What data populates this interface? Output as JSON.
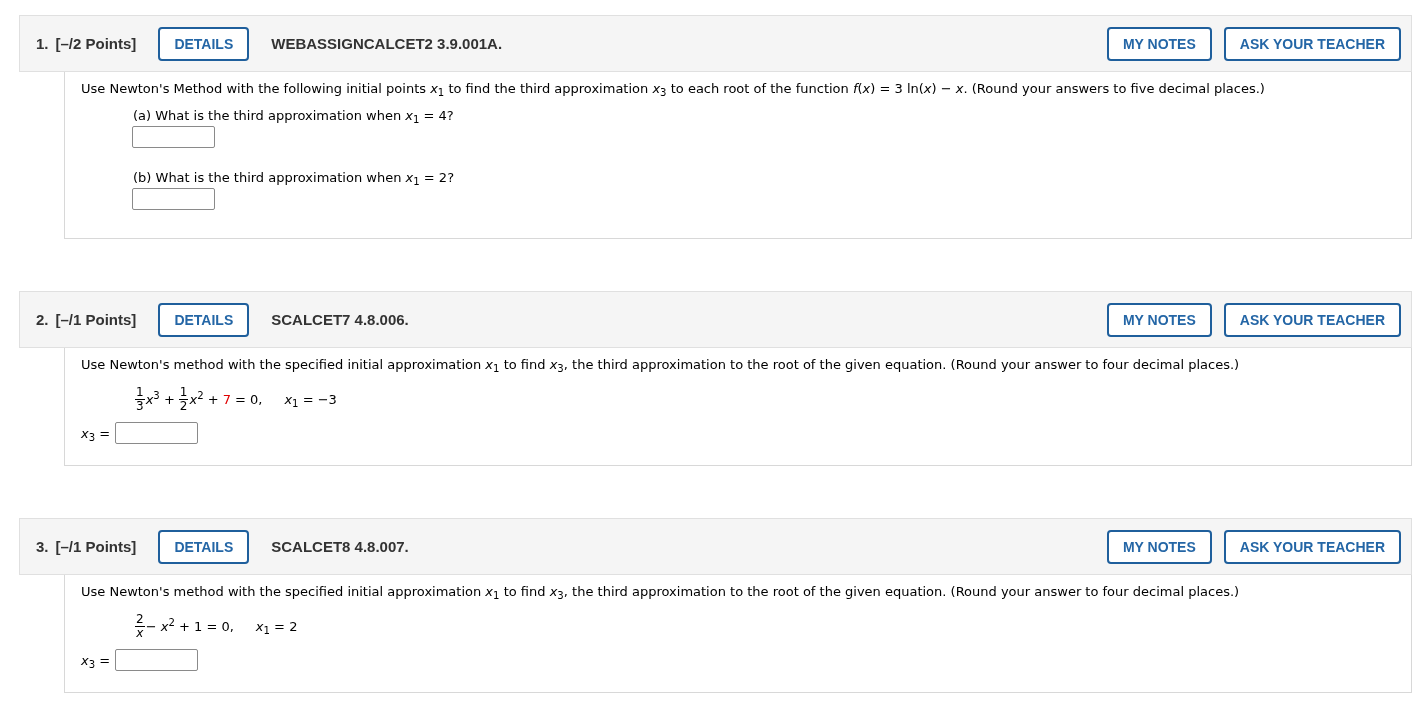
{
  "questions": [
    {
      "number": "1.",
      "points": "[–/2 Points]",
      "details_button": "DETAILS",
      "problem_id": "WEBASSIGNCALCET2 3.9.001A.",
      "actions": [
        "MY NOTES",
        "ASK YOUR TEACHER"
      ],
      "prompt": "Use Newton's Method with the following initial points *x*$_{1}$ to find the third approximation *x*$_{3}$ to each root of the function *f*(*x*) = 3 ln(*x*) − *x*. (Round your answers to five decimal places.)",
      "parts": [
        {
          "prompt": "(a) What is the third approximation when *x*$_{1}$ = 4?"
        },
        {
          "prompt": "(b) What is the third approximation when *x*$_{1}$ = 2?"
        }
      ]
    },
    {
      "number": "2.",
      "points": "[–/1 Points]",
      "details_button": "DETAILS",
      "problem_id": "SCALCET7 4.8.006.",
      "actions": [
        "MY NOTES",
        "ASK YOUR TEACHER"
      ],
      "prompt": "Use Newton's method with the specified initial approximation *x*$_{1}$ to find *x*$_{3}$, the third approximation to the root of the given equation. (Round your answer to four decimal places.)",
      "equation": [
        {
          "kind": "fraction",
          "numerator": "1",
          "denominator": "3"
        },
        {
          "kind": "text",
          "text": "*x*$^{3}$ +"
        },
        {
          "kind": "fraction",
          "numerator": "1",
          "denominator": "2"
        },
        {
          "kind": "text",
          "text": "*x*$^{2}$ +"
        },
        {
          "kind": "text",
          "text": "7",
          "color": "#e00000"
        },
        {
          "kind": "text",
          "text": "= 0,"
        }
      ],
      "initial_value": "*x*$_{1}$ = −3",
      "answer_label": "*x*$_{3}$ ="
    },
    {
      "number": "3.",
      "points": "[–/1 Points]",
      "details_button": "DETAILS",
      "problem_id": "SCALCET8 4.8.007.",
      "actions": [
        "MY NOTES",
        "ASK YOUR TEACHER"
      ],
      "prompt": "Use Newton's method with the specified initial approximation *x*$_{1}$ to find *x*$_{3}$, the third approximation to the root of the given equation. (Round your answer to four decimal places.)",
      "equation": [
        {
          "kind": "fraction",
          "numerator": "2",
          "denominator": "*x*"
        },
        {
          "kind": "text",
          "text": "− *x*$^{2}$ + 1 = 0,"
        }
      ],
      "initial_value": "*x*$_{1}$ = 2",
      "answer_label": "*x*$_{3}$ ="
    }
  ]
}
